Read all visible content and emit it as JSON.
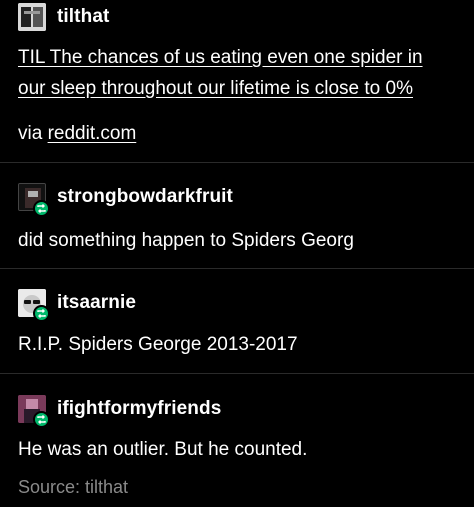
{
  "posts": [
    {
      "username": "tilthat",
      "title_line1": "TIL The chances of us eating even one spider in",
      "title_line2": "our sleep throughout our lifetime is close to 0%",
      "via_label": "via",
      "via_link": "reddit.com"
    },
    {
      "username": "strongbowdarkfruit",
      "text": "did something happen to Spiders Georg"
    },
    {
      "username": "itsaarnie",
      "text": "R.I.P. Spiders George 2013-2017"
    },
    {
      "username": "ifightformyfriends",
      "text": "He was an outlier. But he counted."
    }
  ],
  "source_label": "Source: tilthat",
  "colors": {
    "background": "#000000",
    "text": "#ffffff",
    "muted": "#8a8a8a",
    "reblog_badge": "#00b86b",
    "divider": "#2a2a2a"
  },
  "icons": [
    "reblog-icon"
  ]
}
